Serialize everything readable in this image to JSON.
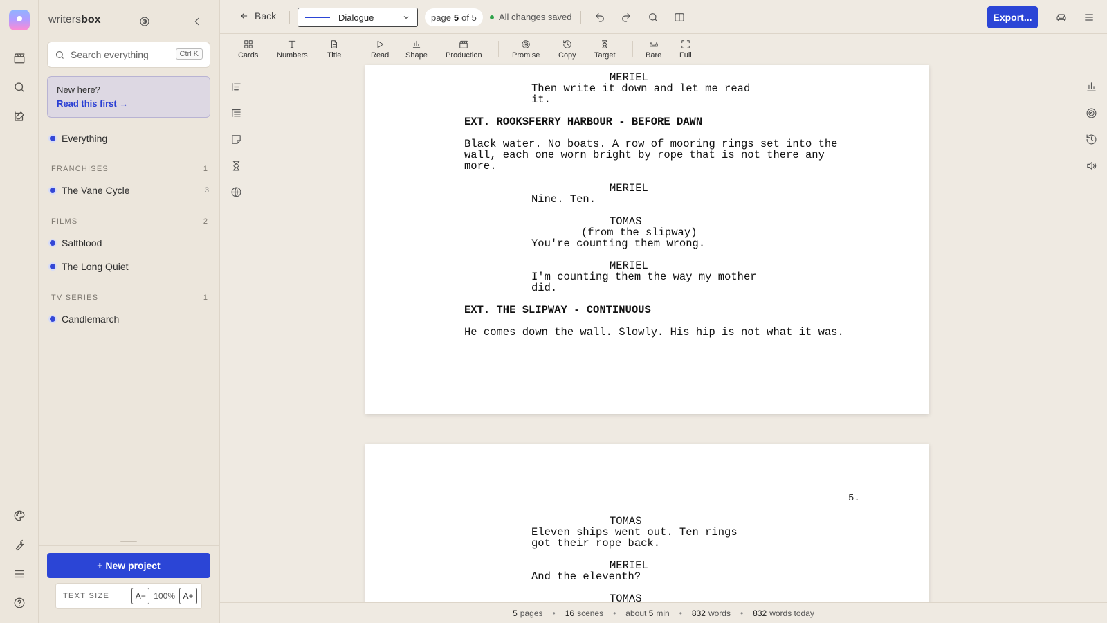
{
  "app": {
    "brand_light": "writers",
    "brand_bold": "box"
  },
  "sidebar": {
    "search_placeholder": "Search everything",
    "search_shortcut": "Ctrl K",
    "welcome_title": "New here?",
    "welcome_link": "Read this first",
    "everything_label": "Everything",
    "sections": [
      {
        "heading": "FRANCHISES",
        "count": "1",
        "items": [
          {
            "label": "The Vane Cycle",
            "count": "3"
          }
        ]
      },
      {
        "heading": "FILMS",
        "count": "2",
        "items": [
          {
            "label": "Saltblood",
            "count": ""
          },
          {
            "label": "The Long Quiet",
            "count": ""
          }
        ]
      },
      {
        "heading": "TV SERIES",
        "count": "1",
        "items": [
          {
            "label": "Candlemarch",
            "count": ""
          }
        ]
      }
    ],
    "new_project_label": "+ New project",
    "text_size_label": "TEXT SIZE",
    "text_size_decrease": "A−",
    "text_size_value": "100%",
    "text_size_increase": "A+"
  },
  "topbar": {
    "back_label": "Back",
    "element_type": "Dialogue",
    "page_prefix": "page",
    "page_current": "5",
    "page_suffix": "of 5",
    "save_status": "All changes saved",
    "export_label": "Export..."
  },
  "toolbar": {
    "tools": [
      {
        "label": "Cards",
        "icon": "grid-icon"
      },
      {
        "label": "Numbers",
        "icon": "type-icon"
      },
      {
        "label": "Title",
        "icon": "file-text-icon"
      },
      {
        "label": "Read",
        "icon": "play-icon"
      },
      {
        "label": "Shape",
        "icon": "bar-chart-icon"
      },
      {
        "label": "Production",
        "icon": "clapperboard-icon"
      },
      {
        "label": "Promise",
        "icon": "target-icon"
      },
      {
        "label": "Copy",
        "icon": "history-icon"
      },
      {
        "label": "Target",
        "icon": "hourglass-icon"
      },
      {
        "label": "Bare",
        "icon": "sofa-icon"
      },
      {
        "label": "Full",
        "icon": "fullscreen-icon"
      }
    ]
  },
  "script": {
    "page1": [
      {
        "type": "char",
        "text": "MERIEL"
      },
      {
        "type": "dia",
        "text": "Then write it down and let me read\nit."
      },
      {
        "type": "head",
        "text": "EXT. ROOKSFERRY HARBOUR - BEFORE DAWN"
      },
      {
        "type": "act",
        "text": "Black water. No boats. A row of mooring rings set into the\nwall, each one worn bright by rope that is not there any\nmore."
      },
      {
        "type": "char",
        "text": "MERIEL"
      },
      {
        "type": "dia",
        "text": "Nine. Ten."
      },
      {
        "type": "char",
        "text": "TOMAS"
      },
      {
        "type": "par",
        "text": "(from the slipway)"
      },
      {
        "type": "dia",
        "text": "You're counting them wrong."
      },
      {
        "type": "char",
        "text": "MERIEL"
      },
      {
        "type": "dia",
        "text": "I'm counting them the way my mother\ndid."
      },
      {
        "type": "head",
        "text": "EXT. THE SLIPWAY - CONTINUOUS"
      },
      {
        "type": "act",
        "text": "He comes down the wall. Slowly. His hip is not what it was."
      }
    ],
    "page2_number": "5.",
    "page2": [
      {
        "type": "char",
        "text": "TOMAS"
      },
      {
        "type": "dia",
        "text": "Eleven ships went out. Ten rings\ngot their rope back."
      },
      {
        "type": "char",
        "text": "MERIEL"
      },
      {
        "type": "dia",
        "text": "And the eleventh?"
      },
      {
        "type": "char",
        "text": "TOMAS"
      }
    ]
  },
  "status": {
    "pages_value": "5",
    "pages_label": "pages",
    "scenes_value": "16",
    "scenes_label": "scenes",
    "time_prefix": "about",
    "time_value": "5",
    "time_label": "min",
    "words_value": "832",
    "words_label": "words",
    "today_value": "832",
    "today_label": "words today"
  },
  "colors": {
    "accent": "#2b45d6",
    "saved_dot": "#2fa24a",
    "background": "#efeae2"
  }
}
